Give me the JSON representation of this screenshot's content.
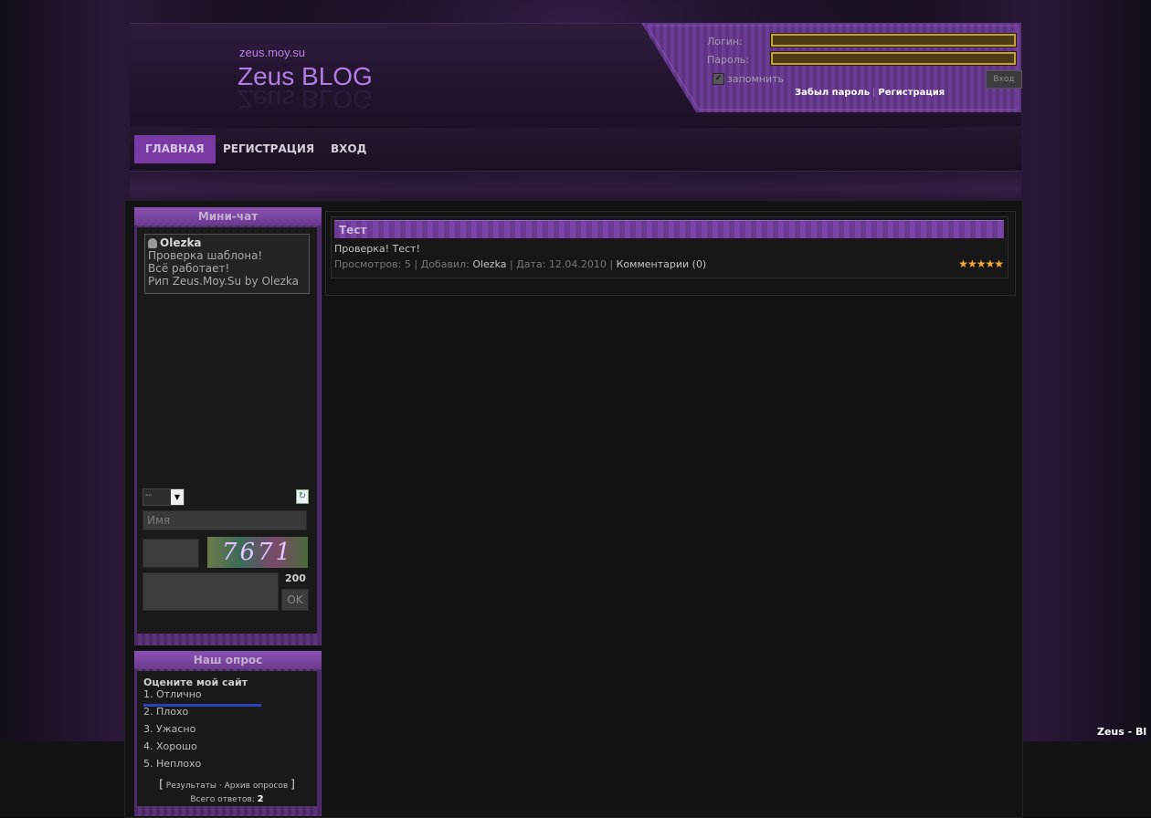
{
  "header": {
    "url": "zeus.moy.su",
    "title": "Zeus BLOG"
  },
  "login": {
    "login_label": "Логин:",
    "password_label": "Пароль:",
    "login_value": "",
    "password_value": "",
    "remember_label": "запомнить",
    "remember_checked": true,
    "forgot_link": "Забыл пароль",
    "separator": "|",
    "register_link": "Регистрация",
    "submit_label": "Вход"
  },
  "nav": {
    "items": [
      {
        "label": "ГЛАВНАЯ",
        "active": true
      },
      {
        "label": "РЕГИСТРАЦИЯ",
        "active": false
      },
      {
        "label": "ВХОД",
        "active": false
      }
    ]
  },
  "minichat": {
    "title": "Мини-чат",
    "messages": [
      {
        "user": "Olezka",
        "lines": [
          "Проверка шаблона!",
          "Всё работает!",
          "Рип Zeus.Moy.Su by Olezka"
        ]
      }
    ],
    "select_value": "--",
    "name_placeholder": "Имя",
    "captcha_text": "7671",
    "char_limit": "200",
    "ok_label": "OK"
  },
  "poll": {
    "title": "Наш опрос",
    "question": "Оцените мой сайт",
    "options": [
      {
        "label": "1. Отлично",
        "fraction": 1.0
      },
      {
        "label": "2. Плохо",
        "fraction": 0
      },
      {
        "label": "3. Ужасно",
        "fraction": 0
      },
      {
        "label": "4. Хорошо",
        "fraction": 0
      },
      {
        "label": "5. Неплохо",
        "fraction": 0
      }
    ],
    "open_bracket": "[",
    "results_link": "Результаты",
    "dot": "·",
    "archive_link": "Архив опросов",
    "close_bracket": "]",
    "total_label": "Всего ответов:",
    "total_value": "2"
  },
  "entry": {
    "title": "Тест",
    "text": "Проверка! Тест!",
    "views_label": "Просмотров:",
    "views": "5",
    "added_label": "Добавил:",
    "author": "Olezka",
    "date_label": "Дата:",
    "date": "12.04.2010",
    "comments": "Комментарии (0)",
    "sep": "|",
    "rating": 5
  },
  "side_title": "Zeus - Bl",
  "colors": {
    "accent": "#7a3aa3",
    "title_purple": "#b27de3",
    "input_border": "#c4a135",
    "poll_bar": "#2c3fbd",
    "star": "#f3a932"
  }
}
